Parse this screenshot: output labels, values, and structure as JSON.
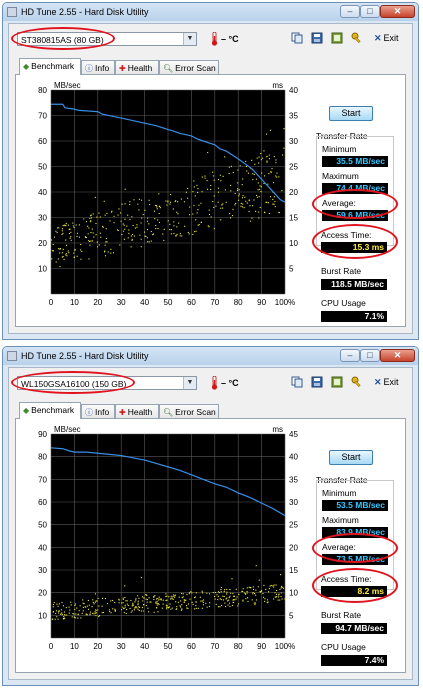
{
  "windows": [
    {
      "title": "HD Tune 2.55 - Hard Disk Utility",
      "drive": "ST380815AS (80 GB)",
      "temperature": "– °C",
      "exit_label": "Exit",
      "tabs": [
        "Benchmark",
        "Info",
        "Health",
        "Error Scan"
      ],
      "start_label": "Start",
      "transfer_rate_label": "Transfer Rate",
      "minimum_label": "Minimum",
      "minimum": "35.5 MB/sec",
      "maximum_label": "Maximum",
      "maximum": "74.4 MB/sec",
      "average_label": "Average:",
      "average": "59.6 MB/sec",
      "access_time_label": "Access Time:",
      "access_time": "15.3 ms",
      "burst_rate_label": "Burst Rate",
      "burst_rate": "118.5 MB/sec",
      "cpu_usage_label": "CPU Usage",
      "cpu_usage": "7.1%",
      "chart_data": {
        "type": "line",
        "ylabel": "MB/sec",
        "y2label": "ms",
        "ylim": [
          0,
          80
        ],
        "y2lim": [
          0,
          40
        ],
        "yticks": [
          "80",
          "70",
          "60",
          "50",
          "40",
          "30",
          "20",
          "10"
        ],
        "y2ticks": [
          "40",
          "35",
          "30",
          "25",
          "20",
          "15",
          "10",
          "5"
        ],
        "xticks": [
          "0",
          "10",
          "20",
          "30",
          "40",
          "50",
          "60",
          "70",
          "80",
          "90",
          "100%"
        ],
        "xlim": [
          0,
          100
        ],
        "grid": true,
        "series": [
          {
            "kind": "transfer",
            "color": "#3a8ee8",
            "x": [
              0,
              5,
              6,
              10,
              12,
              20,
              22,
              30,
              40,
              45,
              50,
              52,
              55,
              60,
              62,
              65,
              70,
              72,
              75,
              80,
              83,
              86,
              88,
              90,
              92,
              94,
              96,
              98,
              100
            ],
            "y": [
              74.4,
              74.4,
              73,
              72.5,
              72,
              71.5,
              70.5,
              69,
              67,
              66,
              64.5,
              64,
              63,
              62,
              61,
              60,
              58.5,
              57,
              56,
              53,
              51,
              49,
              47,
              45,
              43,
              41,
              39,
              37,
              36
            ]
          },
          {
            "kind": "access",
            "color": "#f0ec37",
            "range": [
              0,
              100
            ],
            "trend_start_ms": [
              5,
              13
            ],
            "trend_end_ms": [
              16,
              29
            ]
          }
        ]
      }
    },
    {
      "title": "HD Tune 2.55 - Hard Disk Utility",
      "drive": "WL150GSA16100 (150 GB)",
      "temperature": "– °C",
      "exit_label": "Exit",
      "tabs": [
        "Benchmark",
        "Info",
        "Health",
        "Error Scan"
      ],
      "start_label": "Start",
      "transfer_rate_label": "Transfer Rate",
      "minimum_label": "Minimum",
      "minimum": "53.5 MB/sec",
      "maximum_label": "Maximum",
      "maximum": "83.9 MB/sec",
      "average_label": "Average:",
      "average": "73.5 MB/sec",
      "access_time_label": "Access Time:",
      "access_time": "8.2 ms",
      "burst_rate_label": "Burst Rate",
      "burst_rate": "94.7 MB/sec",
      "cpu_usage_label": "CPU Usage",
      "cpu_usage": "7.4%",
      "chart_data": {
        "type": "line",
        "ylabel": "MB/sec",
        "y2label": "ms",
        "ylim": [
          0,
          90
        ],
        "y2lim": [
          0,
          45
        ],
        "yticks": [
          "90",
          "80",
          "70",
          "60",
          "50",
          "40",
          "30",
          "20",
          "10"
        ],
        "y2ticks": [
          "45",
          "40",
          "35",
          "30",
          "25",
          "20",
          "15",
          "10",
          "5"
        ],
        "xticks": [
          "0",
          "10",
          "20",
          "30",
          "40",
          "50",
          "60",
          "70",
          "80",
          "90",
          "100%"
        ],
        "xlim": [
          0,
          100
        ],
        "grid": true,
        "series": [
          {
            "kind": "transfer",
            "color": "#3a8ee8",
            "x": [
              0,
              5,
              8,
              10,
              15,
              20,
              25,
              30,
              35,
              40,
              45,
              50,
              55,
              60,
              65,
              70,
              75,
              80,
              85,
              90,
              95,
              100
            ],
            "y": [
              83.9,
              83.5,
              82.5,
              82,
              82,
              81.5,
              81,
              80.5,
              79.5,
              78.5,
              77,
              75.5,
              74,
              72,
              70,
              68,
              66.5,
              64,
              62,
              59.5,
              57,
              54
            ]
          },
          {
            "kind": "access",
            "color": "#f0ec37",
            "range": [
              0,
              100
            ],
            "trend_start_ms": [
              4,
              8
            ],
            "trend_end_ms": [
              8,
              12
            ]
          }
        ]
      }
    }
  ]
}
